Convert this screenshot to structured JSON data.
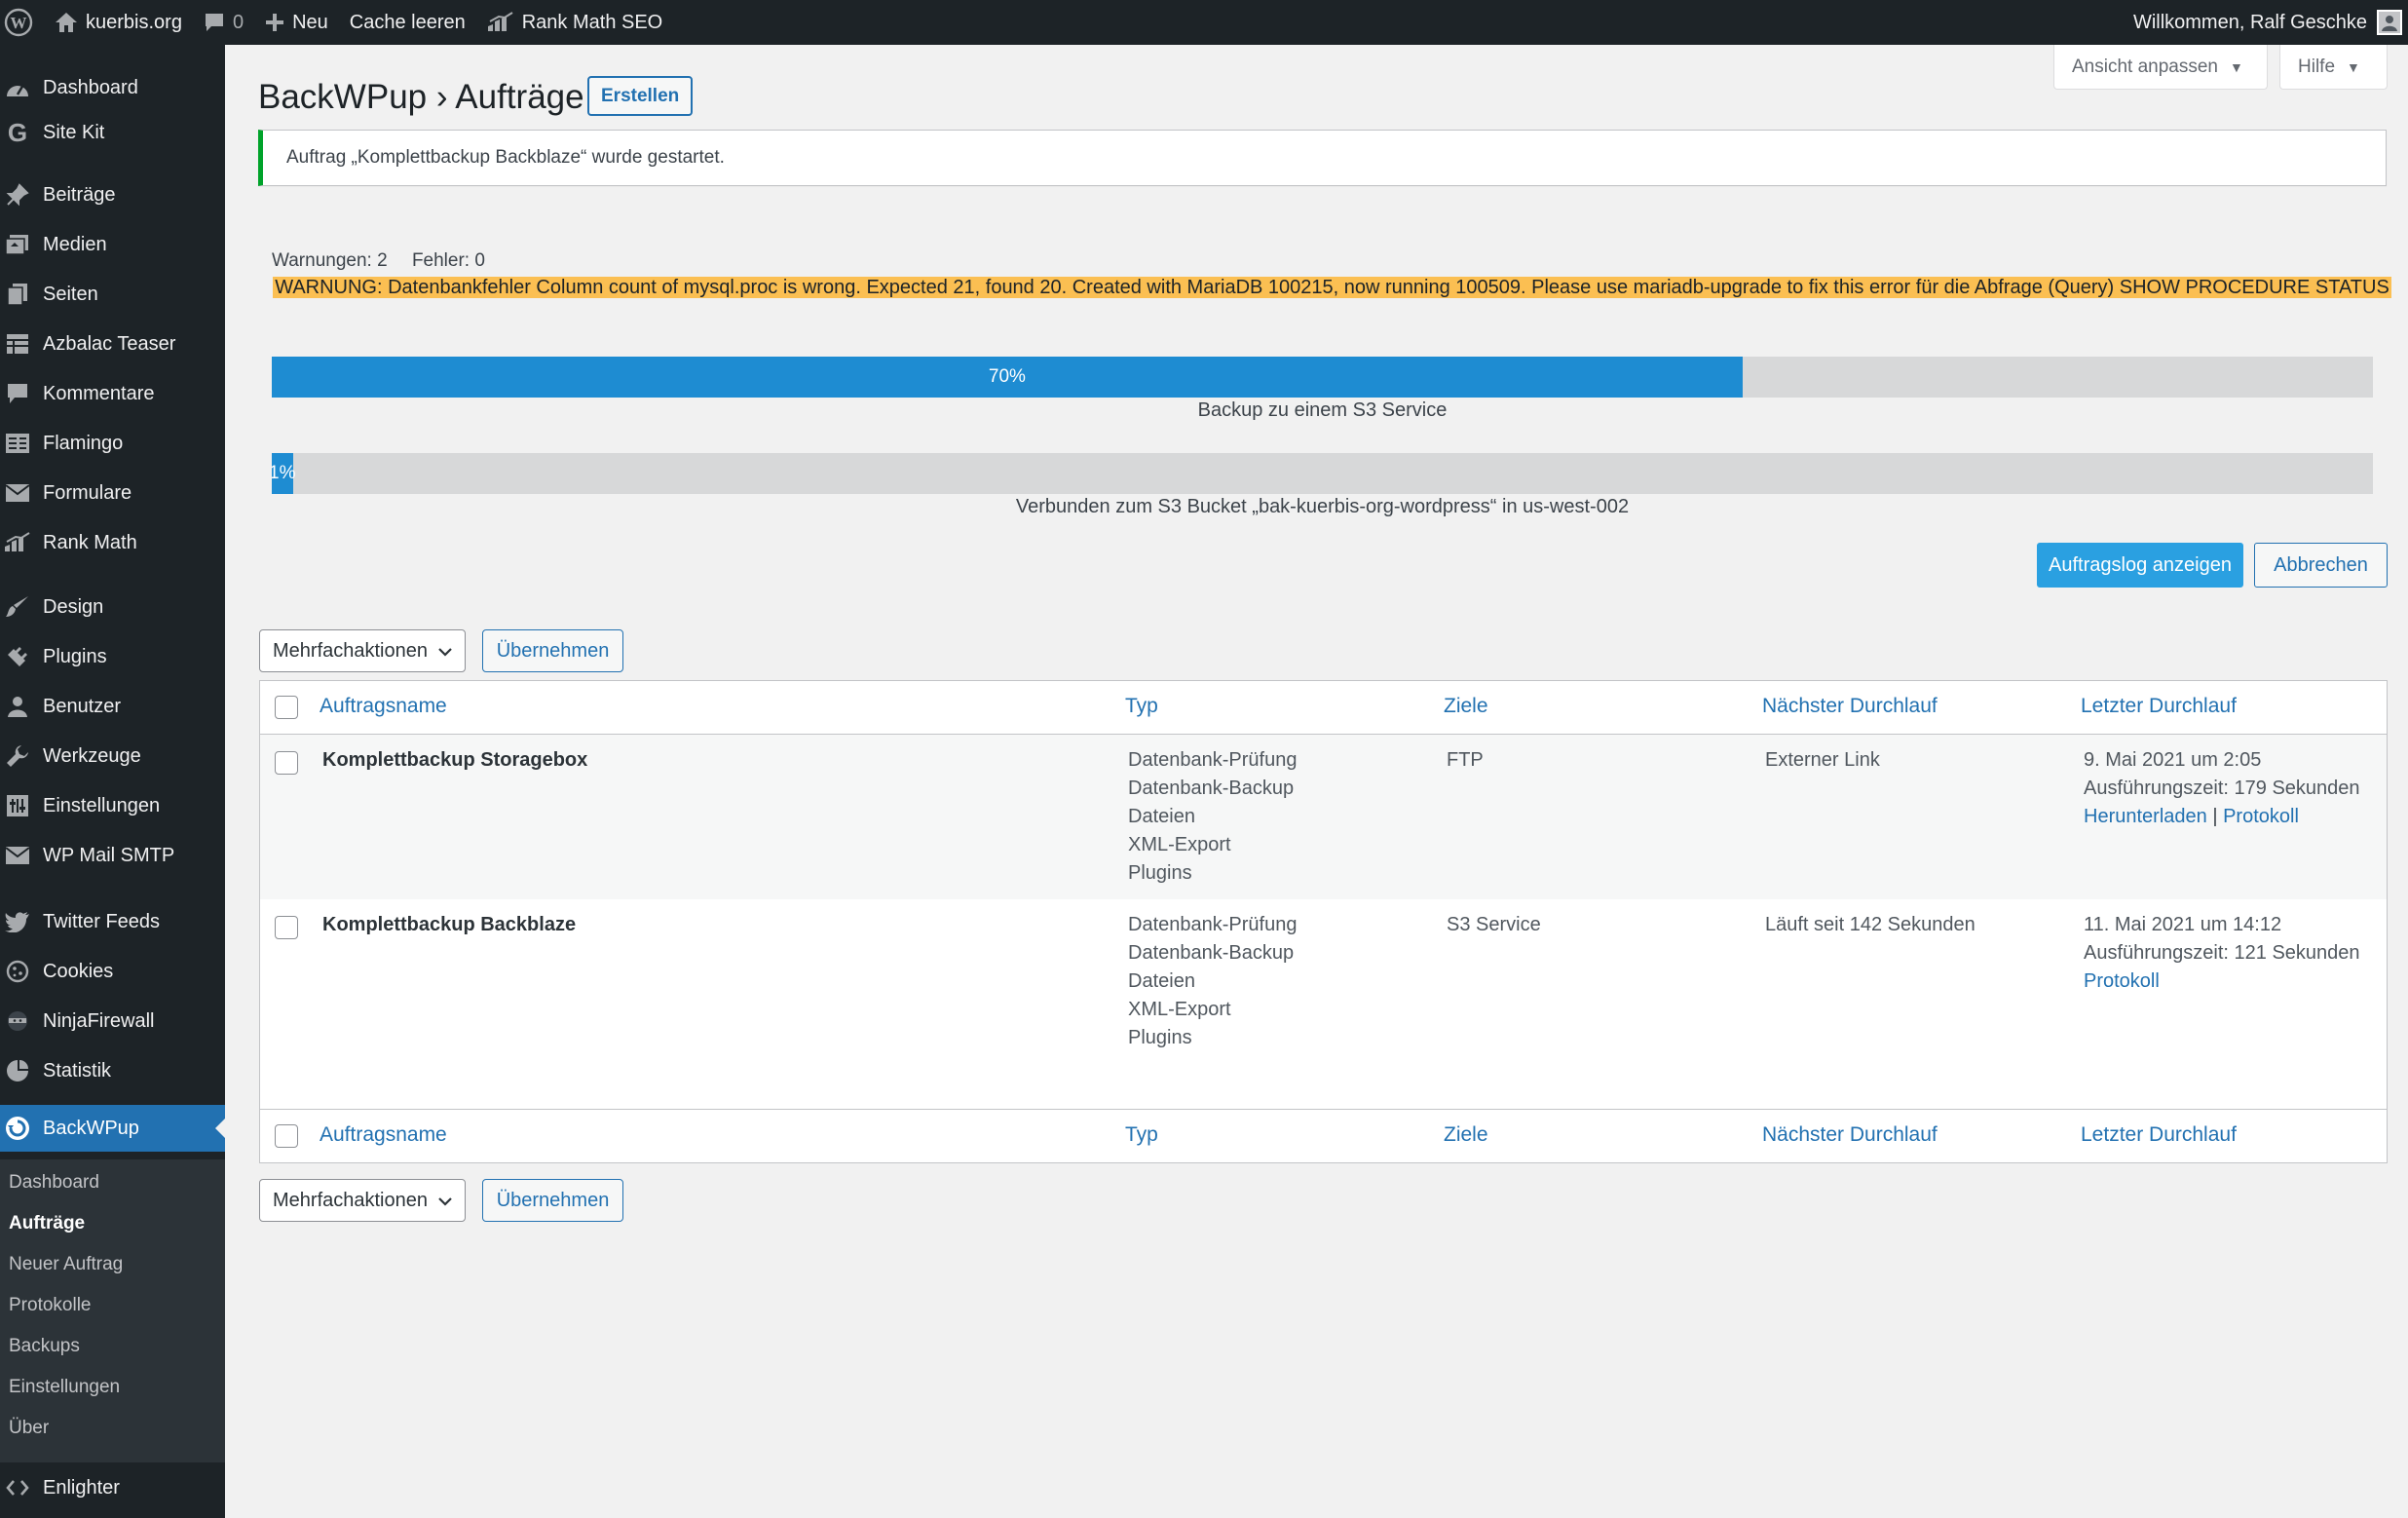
{
  "adminbar": {
    "site_name": "kuerbis.org",
    "comments_count": "0",
    "new_label": "Neu",
    "cache_label": "Cache leeren",
    "seo_label": "Rank Math SEO",
    "greeting": "Willkommen, Ralf Geschke"
  },
  "sidebar": {
    "items": [
      {
        "label": "Dashboard",
        "icon": "dashboard-icon"
      },
      {
        "label": "Site Kit",
        "icon": "google-g-icon"
      },
      {
        "label": "Beiträge",
        "icon": "pin-icon"
      },
      {
        "label": "Medien",
        "icon": "media-icon"
      },
      {
        "label": "Seiten",
        "icon": "pages-icon"
      },
      {
        "label": "Azbalac Teaser",
        "icon": "table-icon"
      },
      {
        "label": "Kommentare",
        "icon": "comment-icon"
      },
      {
        "label": "Flamingo",
        "icon": "flamingo-icon"
      },
      {
        "label": "Formulare",
        "icon": "mail-icon"
      },
      {
        "label": "Rank Math",
        "icon": "rankmath-icon"
      },
      {
        "label": "Design",
        "icon": "brush-icon"
      },
      {
        "label": "Plugins",
        "icon": "plugin-icon"
      },
      {
        "label": "Benutzer",
        "icon": "user-icon"
      },
      {
        "label": "Werkzeuge",
        "icon": "wrench-icon"
      },
      {
        "label": "Einstellungen",
        "icon": "settings-icon"
      },
      {
        "label": "WP Mail SMTP",
        "icon": "mail-icon"
      },
      {
        "label": "Twitter Feeds",
        "icon": "twitter-icon"
      },
      {
        "label": "Cookies",
        "icon": "cookie-icon"
      },
      {
        "label": "NinjaFirewall",
        "icon": "ninja-icon"
      },
      {
        "label": "Statistik",
        "icon": "chart-pie-icon"
      },
      {
        "label": "BackWPup",
        "icon": "backwpup-icon"
      }
    ],
    "submenu": [
      "Dashboard",
      "Aufträge",
      "Neuer Auftrag",
      "Protokolle",
      "Backups",
      "Einstellungen",
      "Über"
    ],
    "enlighter": "Enlighter"
  },
  "screen_meta": {
    "options_label": "Ansicht anpassen",
    "help_label": "Hilfe"
  },
  "page": {
    "title": "BackWPup › Aufträge",
    "add_button": "Erstellen",
    "notice": "Auftrag „Komplettbackup Backblaze“ wurde gestartet."
  },
  "status": {
    "warnings": "Warnungen: 2",
    "errors": "Fehler: 0",
    "warning_text": "WARNUNG: Datenbankfehler Column count of mysql.proc is wrong. Expected 21, found 20. Created with MariaDB 100215, now running 100509. Please use mariadb-upgrade to fix this error für die Abfrage (Query) SHOW PROCEDURE STATUS",
    "warning_color": "#fbbf52",
    "progress1": {
      "value": 70,
      "label": "70%",
      "caption": "Backup zu einem S3 Service"
    },
    "progress2": {
      "value": 1,
      "label": "1%",
      "caption": "Verbunden zum S3 Bucket „bak-kuerbis-org-wordpress“ in us-west-002"
    },
    "log_button": "Auftragslog anzeigen",
    "cancel_button": "Abbrechen"
  },
  "bulk": {
    "select_value": "Mehrfachaktionen",
    "apply": "Übernehmen"
  },
  "table": {
    "columns": [
      "Auftragsname",
      "Typ",
      "Ziele",
      "Nächster Durchlauf",
      "Letzter Durchlauf"
    ],
    "rows": [
      {
        "name": "Komplettbackup Storagebox",
        "types": [
          "Datenbank-Prüfung",
          "Datenbank-Backup",
          "Dateien",
          "XML-Export",
          "Plugins"
        ],
        "target": "FTP",
        "next": "Externer Link",
        "last_date": "9. Mai 2021 um 2:05",
        "runtime": "Ausführungszeit: 179 Sekunden",
        "link1": "Herunterladen",
        "separator": "|",
        "link2": "Protokoll"
      },
      {
        "name": "Komplettbackup Backblaze",
        "types": [
          "Datenbank-Prüfung",
          "Datenbank-Backup",
          "Dateien",
          "XML-Export",
          "Plugins"
        ],
        "target": "S3 Service",
        "next": "Läuft seit 142 Sekunden",
        "last_date": "11. Mai 2021 um 14:12",
        "runtime": "Ausführungszeit: 121 Sekunden",
        "link1": "Protokoll"
      }
    ]
  },
  "colors": {
    "accent": "#2271b1",
    "progress": "#1e8cd2",
    "sidebar_bg": "#1d2327",
    "success": "#00a32a"
  }
}
